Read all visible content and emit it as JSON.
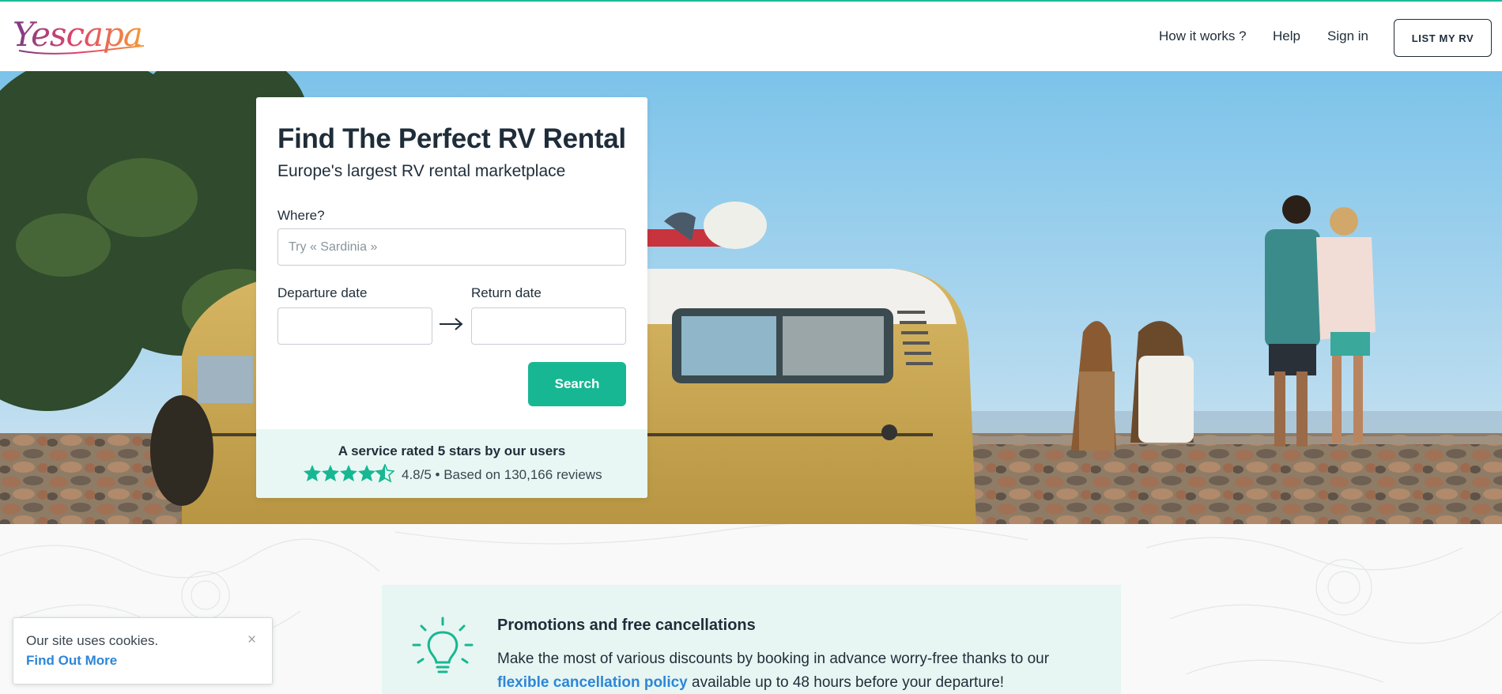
{
  "brand": {
    "logo_text": "Yescapa",
    "accent": "#17b793",
    "link_color": "#2d86d8"
  },
  "nav": {
    "how_it_works": "How it works ?",
    "help": "Help",
    "sign_in": "Sign in",
    "list_my_rv": "LIST MY RV"
  },
  "search": {
    "title": "Find The Perfect RV Rental",
    "subtitle": "Europe's largest RV rental marketplace",
    "where_label": "Where?",
    "where_placeholder": "Try « Sardinia »",
    "departure_label": "Departure date",
    "departure_value": "",
    "return_label": "Return date",
    "return_value": "",
    "search_button": "Search"
  },
  "rating": {
    "title": "A service rated 5 stars by our users",
    "stars": 4.5,
    "text": "4.8/5 • Based on 130,166 reviews"
  },
  "promo": {
    "icon": "lightbulb-icon",
    "title": "Promotions and free cancellations",
    "text_before": "Make the most of various discounts by booking in advance worry-free thanks to our ",
    "link": "flexible cancellation policy",
    "text_after": " available up to 48 hours before your departure!"
  },
  "cookie": {
    "text": "Our site uses cookies.",
    "link": "Find Out More",
    "close": "×"
  }
}
